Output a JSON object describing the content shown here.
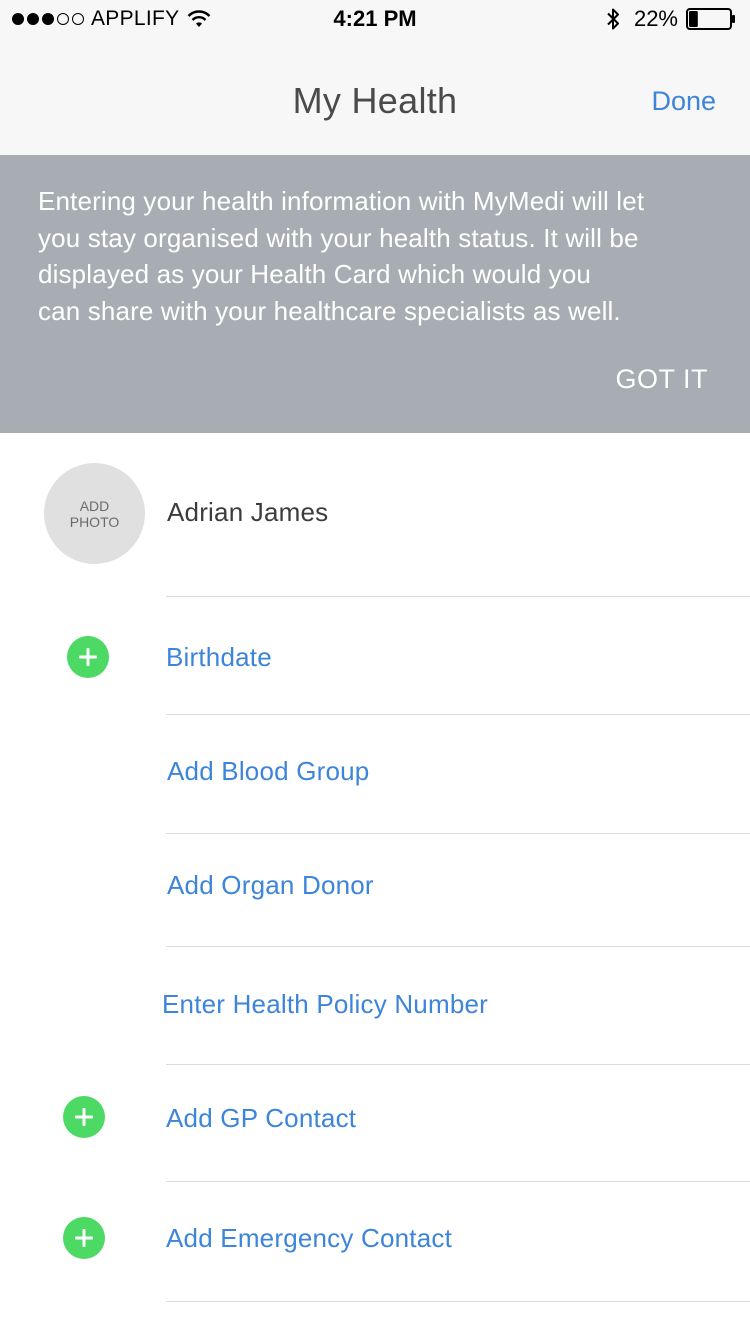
{
  "status_bar": {
    "carrier": "APPLIFY",
    "time": "4:21 PM",
    "battery_percent": "22%",
    "signal_bars": 3,
    "signal_total": 5,
    "battery_level": 0.22
  },
  "nav": {
    "title": "My Health",
    "done_label": "Done"
  },
  "banner": {
    "lines": [
      "Entering your health information with MyMedi will let",
      "you stay organised with your health status. It will be",
      "displayed as your Health Card which would you",
      "can share with your healthcare specialists as well."
    ],
    "action_label": "GOT IT"
  },
  "profile": {
    "avatar_line1": "ADD",
    "avatar_line2": "PHOTO",
    "name": "Adrian James"
  },
  "items": [
    {
      "label": "Birthdate",
      "icon": "plus-circle-icon",
      "has_icon": true
    },
    {
      "label": "Add Blood Group",
      "has_icon": false
    },
    {
      "label": "Add Organ Donor",
      "has_icon": false
    },
    {
      "label": "Enter Health Policy Number",
      "has_icon": false
    },
    {
      "label": "Add GP Contact",
      "icon": "plus-circle-icon",
      "has_icon": true
    },
    {
      "label": "Add Emergency Contact",
      "icon": "plus-circle-icon",
      "has_icon": true
    }
  ],
  "colors": {
    "accent": "#3d85d9",
    "banner_bg": "#a7adb3",
    "add_green": "#4cd964",
    "nav_bg": "#f7f7f7"
  }
}
